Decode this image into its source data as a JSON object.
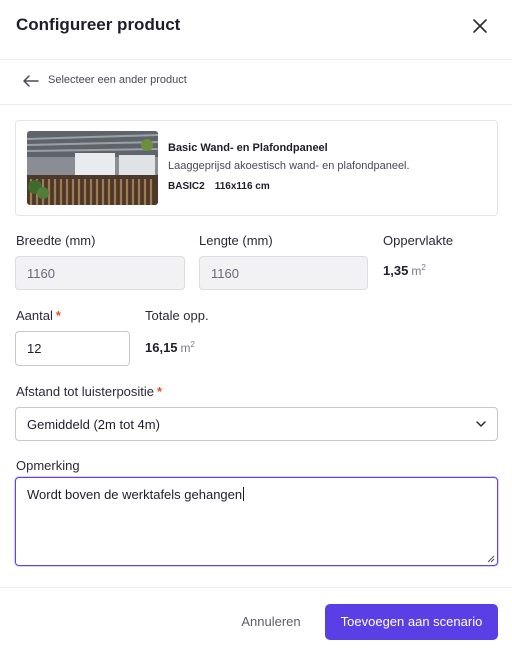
{
  "dialog": {
    "title": "Configureer product",
    "close_icon": "close-icon"
  },
  "back_link": {
    "label": "Selecteer een ander product",
    "icon": "arrow-left-icon"
  },
  "product": {
    "name": "Basic Wand- en Plafondpaneel",
    "description": "Laaggeprijsd akoestisch wand- en plafondpaneel.",
    "code": "BASIC2",
    "size": "116x116 cm"
  },
  "fields": {
    "width": {
      "label": "Breedte (mm)",
      "value": "1160"
    },
    "length": {
      "label": "Lengte (mm)",
      "value": "1160"
    },
    "area": {
      "label": "Oppervlakte",
      "value": "1,35",
      "unit": "m",
      "unit_sup": "2"
    },
    "quantity": {
      "label": "Aantal",
      "required_mark": "*",
      "value": "12"
    },
    "total_area": {
      "label": "Totale opp.",
      "value": "16,15",
      "unit": "m",
      "unit_sup": "2"
    },
    "distance": {
      "label": "Afstand tot luisterpositie",
      "required_mark": "*",
      "selected": "Gemiddeld (2m tot 4m)"
    },
    "remark": {
      "label": "Opmerking",
      "value": "Wordt boven de werktafels gehangen"
    }
  },
  "footer": {
    "cancel_label": "Annuleren",
    "submit_label": "Toevoegen aan scenario"
  },
  "colors": {
    "accent": "#5b3fe6",
    "focus_border": "#6d3fd9",
    "required": "#e0522a"
  }
}
